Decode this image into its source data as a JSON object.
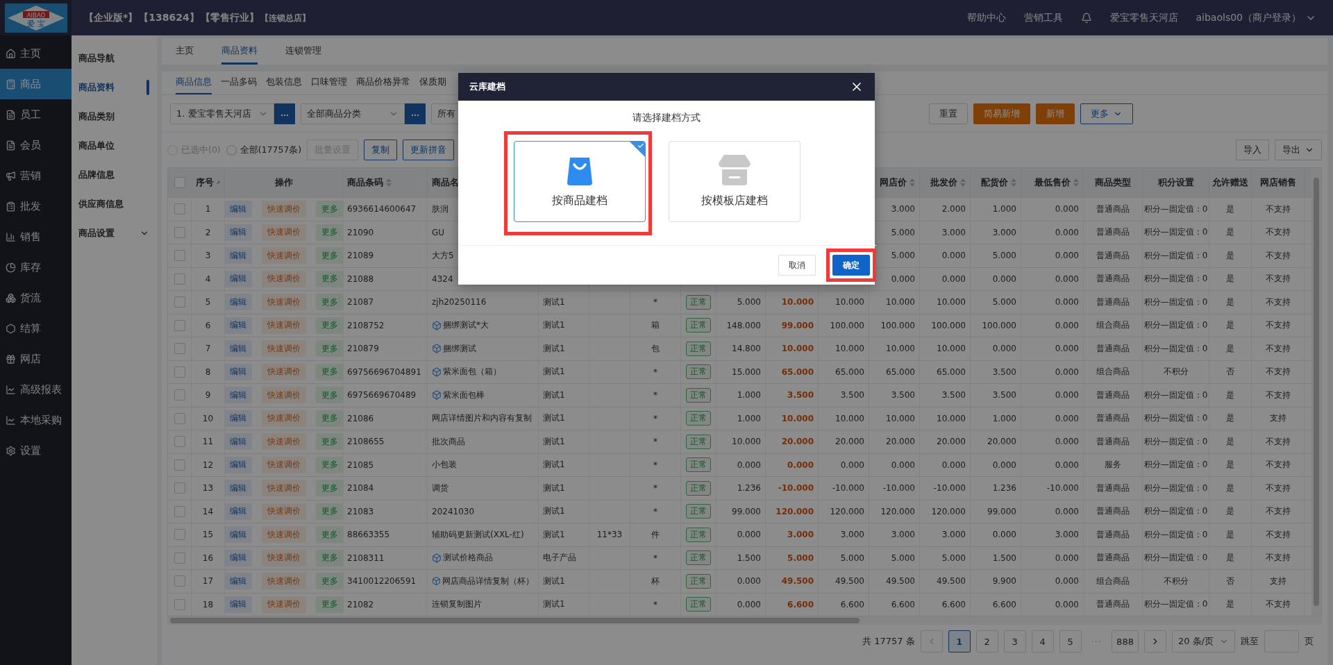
{
  "logo": {
    "text": "AIBAO",
    "subtext": "爱 宝"
  },
  "header": {
    "tags": [
      "【企业版*】",
      "【138624】",
      "【零售行业】"
    ],
    "branch": "【连锁总店】",
    "links": [
      "帮助中心",
      "营销工具"
    ],
    "store": "爱宝零售天河店",
    "user": "aibaols00（商户登录）"
  },
  "nav": [
    {
      "label": "主页",
      "selected": false
    },
    {
      "label": "商品",
      "selected": true
    },
    {
      "label": "员工",
      "selected": false
    },
    {
      "label": "会员",
      "selected": false
    },
    {
      "label": "营销",
      "selected": false
    },
    {
      "label": "批发",
      "selected": false
    },
    {
      "label": "销售",
      "selected": false
    },
    {
      "label": "库存",
      "selected": false
    },
    {
      "label": "货流",
      "selected": false
    },
    {
      "label": "结算",
      "selected": false
    },
    {
      "label": "网店",
      "selected": false
    },
    {
      "label": "高级报表",
      "selected": false
    },
    {
      "label": "本地采购",
      "selected": false
    },
    {
      "label": "设置",
      "selected": false
    }
  ],
  "submenu": [
    {
      "label": "商品导航",
      "selected": false,
      "expandable": false
    },
    {
      "label": "商品资料",
      "selected": true,
      "expandable": false
    },
    {
      "label": "商品类别",
      "selected": false,
      "expandable": false
    },
    {
      "label": "商品单位",
      "selected": false,
      "expandable": false
    },
    {
      "label": "品牌信息",
      "selected": false,
      "expandable": false
    },
    {
      "label": "供应商信息",
      "selected": false,
      "expandable": false
    },
    {
      "label": "商品设置",
      "selected": false,
      "expandable": true
    }
  ],
  "page_tabs": [
    {
      "label": "主页",
      "selected": false
    },
    {
      "label": "商品资料",
      "selected": true
    },
    {
      "label": "连锁管理",
      "selected": false
    }
  ],
  "sub_tabs": [
    {
      "label": "商品信息",
      "selected": true
    },
    {
      "label": "一品多码",
      "selected": false
    },
    {
      "label": "包装信息",
      "selected": false
    },
    {
      "label": "口味管理",
      "selected": false
    },
    {
      "label": "商品价格异常",
      "selected": false
    },
    {
      "label": "保质期",
      "selected": false
    }
  ],
  "filters": [
    {
      "value": "1. 爱宝零售天河店",
      "picker": true
    },
    {
      "value": "全部商品分类",
      "picker": true
    },
    {
      "value": "所有",
      "picker": false
    }
  ],
  "filter_buttons": [
    {
      "label": "重置",
      "kind": "plain"
    },
    {
      "label": "简易新增",
      "kind": "primary"
    },
    {
      "label": "新增",
      "kind": "primary"
    },
    {
      "label": "更多",
      "kind": "dropdown"
    }
  ],
  "selection": [
    {
      "label": "已选中(0)",
      "selected": false,
      "disabled": true
    },
    {
      "label": "全部(17757条)",
      "selected": false,
      "disabled": false
    }
  ],
  "actions": [
    {
      "label": "批量设置",
      "disabled": true
    },
    {
      "label": "复制",
      "disabled": false
    },
    {
      "label": "更新拼音",
      "disabled": false
    }
  ],
  "io_buttons": [
    {
      "label": "导入",
      "dropdown": false
    },
    {
      "label": "导出",
      "dropdown": true
    }
  ],
  "table": {
    "all_checked": false,
    "actions_header": "操作",
    "columns": [
      {
        "label": "序号",
        "kind": "index",
        "sortable": false
      },
      {
        "label": "商品条码",
        "kind": "text",
        "sortable": true
      },
      {
        "label": "商品名",
        "kind": "name"
      },
      {
        "kind": "text"
      },
      {
        "kind": "center"
      },
      {
        "kind": "center"
      },
      {
        "kind": "status"
      },
      {
        "kind": "number"
      },
      {
        "kind": "emphasis"
      },
      {
        "kind": "number"
      },
      {
        "label": "网店价",
        "kind": "number",
        "sortable": true
      },
      {
        "label": "批发价",
        "kind": "number",
        "sortable": true
      },
      {
        "label": "配货价",
        "kind": "number",
        "sortable": true
      },
      {
        "label": "最低售价",
        "kind": "number",
        "sortable": true
      },
      {
        "label": "商品类型",
        "kind": "center",
        "sortable": false
      },
      {
        "label": "积分设置",
        "kind": "center",
        "sortable": false
      },
      {
        "label": "允许赠送",
        "kind": "center",
        "sortable": false
      },
      {
        "label": "网店销售",
        "kind": "center",
        "sortable": false
      }
    ],
    "rows": [
      {
        "checked": false,
        "bundle": false,
        "actions": [
          "编辑",
          "快速调价",
          "更多"
        ],
        "cells": [
          "1",
          "6936614600647",
          "肤润",
          null,
          null,
          null,
          null,
          null,
          null,
          null,
          "3.000",
          "2.000",
          "1.000",
          "0.000",
          "普通商品",
          "积分—固定值：0",
          "是",
          "不支持"
        ]
      },
      {
        "checked": false,
        "bundle": false,
        "actions": [
          "编辑",
          "快速调价",
          "更多"
        ],
        "cells": [
          "2",
          "21090",
          "GU",
          null,
          null,
          null,
          null,
          null,
          null,
          null,
          "5.000",
          "3.000",
          "3.000",
          "0.000",
          "普通商品",
          "积分—固定值：0",
          "是",
          "不支持"
        ]
      },
      {
        "checked": false,
        "bundle": false,
        "actions": [
          "编辑",
          "快速调价",
          "更多"
        ],
        "cells": [
          "3",
          "21089",
          "大方5",
          null,
          null,
          null,
          null,
          null,
          null,
          null,
          "5.000",
          "0.000",
          "5.000",
          "0.000",
          "普通商品",
          "积分—固定值：0",
          "是",
          "不支持"
        ]
      },
      {
        "checked": false,
        "bundle": false,
        "actions": [
          "编辑",
          "快速调价",
          "更多"
        ],
        "cells": [
          "4",
          "21088",
          "4324",
          null,
          null,
          null,
          null,
          null,
          null,
          null,
          "0.000",
          "0.000",
          "0.000",
          "0.000",
          "普通商品",
          "积分—固定值：0",
          "是",
          "不支持"
        ]
      },
      {
        "checked": false,
        "bundle": false,
        "actions": [
          "编辑",
          "快速调价",
          "更多"
        ],
        "cells": [
          "5",
          "21087",
          "zjh20250116",
          "测试1",
          null,
          "*",
          "正常",
          "5.000",
          "10.000",
          "10.000",
          "10.000",
          "10.000",
          "5.000",
          "0.000",
          "普通商品",
          "积分—固定值：0",
          "是",
          "不支持"
        ]
      },
      {
        "checked": false,
        "bundle": true,
        "actions": [
          "编辑",
          "快速调价",
          "更多"
        ],
        "cells": [
          "6",
          "2108752",
          "捆绑测试*大",
          "测试1",
          null,
          "箱",
          "正常",
          "148.000",
          "99.000",
          "100.000",
          "100.000",
          "100.000",
          "100.000",
          "0.000",
          "组合商品",
          "积分—固定值：0",
          "是",
          "不支持"
        ]
      },
      {
        "checked": false,
        "bundle": true,
        "actions": [
          "编辑",
          "快速调价",
          "更多"
        ],
        "cells": [
          "7",
          "210879",
          "捆绑测试",
          "测试1",
          null,
          "包",
          "正常",
          "14.800",
          "10.000",
          "10.000",
          "10.000",
          "10.000",
          "0.000",
          "0.000",
          "普通商品",
          "积分—固定值：0",
          "是",
          "不支持"
        ]
      },
      {
        "checked": false,
        "bundle": true,
        "actions": [
          "编辑",
          "快速调价",
          "更多"
        ],
        "cells": [
          "8",
          "69756696704891",
          "紫米面包（箱）",
          "测试1",
          null,
          "*",
          "正常",
          "15.000",
          "65.000",
          "65.000",
          "65.000",
          "65.000",
          "3.500",
          "0.000",
          "组合商品",
          "不积分",
          "否",
          "不支持"
        ]
      },
      {
        "checked": false,
        "bundle": true,
        "actions": [
          "编辑",
          "快速调价",
          "更多"
        ],
        "cells": [
          "9",
          "6975669670489",
          "紫米面包棒",
          "测试1",
          null,
          "*",
          "正常",
          "1.000",
          "3.500",
          "3.500",
          "3.500",
          "3.500",
          "3.500",
          "0.000",
          "普通商品",
          "积分—固定值：0",
          "是",
          "不支持"
        ]
      },
      {
        "checked": false,
        "bundle": false,
        "actions": [
          "编辑",
          "快速调价",
          "更多"
        ],
        "cells": [
          "10",
          "21086",
          "网店详情图片和内容有复制",
          "测试1",
          null,
          "*",
          "正常",
          "1.000",
          "10.000",
          "10.000",
          "10.000",
          "10.000",
          "1.000",
          "0.000",
          "普通商品",
          "积分—固定值：0",
          "是",
          "支持"
        ]
      },
      {
        "checked": false,
        "bundle": false,
        "actions": [
          "编辑",
          "快速调价",
          "更多"
        ],
        "cells": [
          "11",
          "2108655",
          "批次商品",
          "测试1",
          null,
          "*",
          "正常",
          "10.000",
          "20.000",
          "20.000",
          "20.000",
          "20.000",
          "20.000",
          "0.000",
          "普通商品",
          "积分—固定值：0",
          "是",
          "不支持"
        ]
      },
      {
        "checked": false,
        "bundle": false,
        "actions": [
          "编辑",
          "快速调价",
          "更多"
        ],
        "cells": [
          "12",
          "21085",
          "小包装",
          "测试1",
          null,
          "*",
          "正常",
          "0.000",
          "0.000",
          "0.000",
          "0.000",
          "0.000",
          "0.000",
          "0.000",
          "服务",
          "积分—固定值：0",
          "是",
          "不支持"
        ]
      },
      {
        "checked": false,
        "bundle": false,
        "actions": [
          "编辑",
          "快速调价",
          "更多"
        ],
        "cells": [
          "13",
          "21084",
          "调货",
          "测试1",
          null,
          "*",
          "正常",
          "1.236",
          "-10.000",
          "-10.000",
          "-10.000",
          "-10.000",
          "1.236",
          "-10.000",
          "普通商品",
          "积分—固定值：0",
          "是",
          "不支持"
        ]
      },
      {
        "checked": false,
        "bundle": false,
        "actions": [
          "编辑",
          "快速调价",
          "更多"
        ],
        "cells": [
          "14",
          "21083",
          "20241030",
          "测试1",
          null,
          "*",
          "正常",
          "99.000",
          "120.000",
          "120.000",
          "120.000",
          "120.000",
          "99.000",
          "0.000",
          "普通商品",
          "积分—固定值：0",
          "是",
          "不支持"
        ]
      },
      {
        "checked": false,
        "bundle": false,
        "actions": [
          "编辑",
          "快速调价",
          "更多"
        ],
        "cells": [
          "15",
          "88663355",
          "辅助码更新测试(XXL-红)",
          "测试1",
          "11*33",
          "件",
          "正常",
          "0.000",
          "3.000",
          "3.000",
          "3.000",
          "3.000",
          "0.000",
          "3.000",
          "普通商品",
          "积分—固定值：0",
          "是",
          "不支持"
        ]
      },
      {
        "checked": false,
        "bundle": true,
        "actions": [
          "编辑",
          "快速调价",
          "更多"
        ],
        "cells": [
          "16",
          "2108311",
          "测试价格商品",
          "电子产品",
          null,
          "*",
          "正常",
          "1.500",
          "5.000",
          "5.000",
          "5.000",
          "5.000",
          "1.500",
          "0.000",
          "普通商品",
          "积分—固定值：0",
          "是",
          "不支持"
        ]
      },
      {
        "checked": false,
        "bundle": true,
        "actions": [
          "编辑",
          "快速调价",
          "更多"
        ],
        "cells": [
          "17",
          "3410012206591",
          "网店商品详情复制（杯）",
          "测试1",
          null,
          "杯",
          "正常",
          "0.000",
          "49.500",
          "49.500",
          "49.500",
          "49.500",
          "9.900",
          "0.000",
          "组合商品",
          "不积分",
          "否",
          "支持"
        ]
      },
      {
        "checked": false,
        "bundle": false,
        "actions": [
          "编辑",
          "快速调价",
          "更多"
        ],
        "cells": [
          "18",
          "21082",
          "连锁复制图片",
          "测试1",
          null,
          "*",
          "正常",
          "0.000",
          "6.600",
          "6.600",
          "6.600",
          "6.600",
          "6.600",
          "0.000",
          "普通商品",
          "积分—固定值：0",
          "是",
          "不支持"
        ]
      }
    ]
  },
  "pagination": {
    "total": "共 17757 条",
    "pages": [
      {
        "label": "1",
        "kind": "page",
        "selected": true
      },
      {
        "label": "2",
        "kind": "page",
        "selected": false
      },
      {
        "label": "3",
        "kind": "page",
        "selected": false
      },
      {
        "label": "4",
        "kind": "page",
        "selected": false
      },
      {
        "label": "5",
        "kind": "page",
        "selected": false
      },
      {
        "label": "···",
        "kind": "ellipsis"
      },
      {
        "label": "888",
        "kind": "page",
        "selected": false
      }
    ],
    "page_size": "20 条/页",
    "jump_label": "跳至",
    "page_unit": "页"
  },
  "modal": {
    "title": "云库建档",
    "prompt": "请选择建档方式",
    "options": [
      {
        "label": "按商品建档",
        "kind": "product",
        "selected": true,
        "highlighted": true
      },
      {
        "label": "按模板店建档",
        "kind": "template",
        "selected": false,
        "highlighted": false
      }
    ],
    "buttons": [
      {
        "label": "取消",
        "kind": "default",
        "highlighted": false
      },
      {
        "label": "确定",
        "kind": "primary",
        "highlighted": true
      }
    ]
  }
}
